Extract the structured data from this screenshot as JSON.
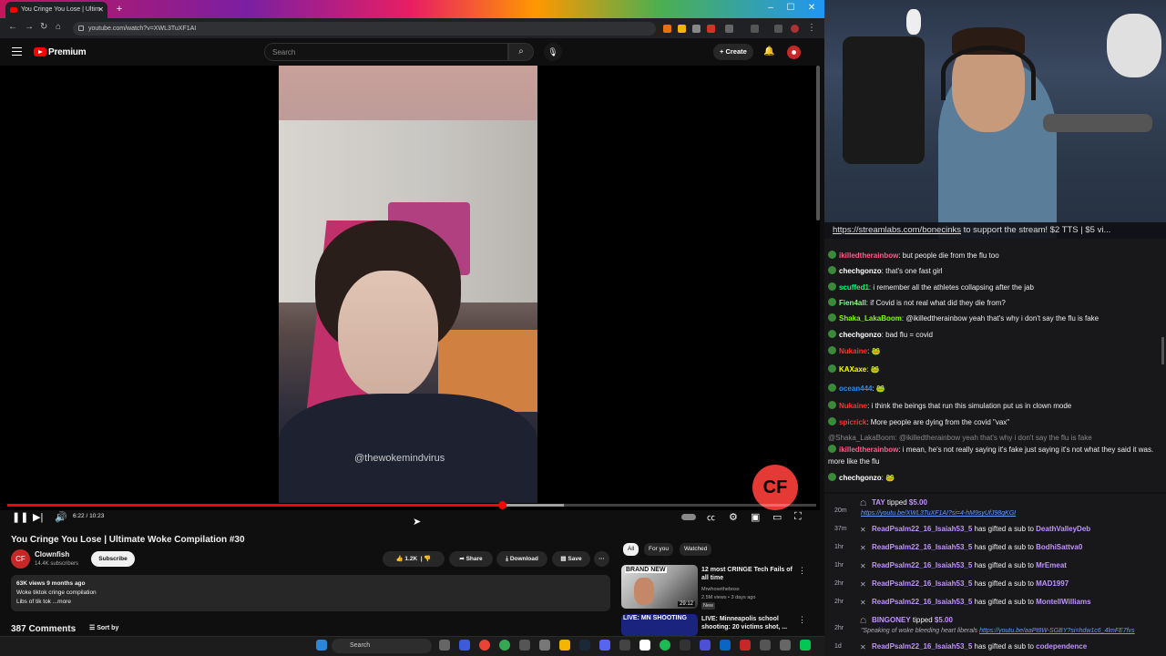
{
  "browser": {
    "tab_title": "You Cringe You Lose | Ultim",
    "tab_close": "✕",
    "new_tab": "+",
    "url": "youtube.com/watch?v=XWL3TuXF1AI",
    "win_minimize": "–",
    "win_maximize": "☐",
    "win_close": "✕"
  },
  "youtube": {
    "brand": "Premium",
    "search_placeholder": "Search",
    "create_label": "Create",
    "video": {
      "watermark": "@thewokemindvirus",
      "timecode": "6:22 / 10:23",
      "progress_fraction": 0.6116,
      "buffer_end_fraction": 0.688,
      "brand_logo_text": "CF"
    },
    "title": "You Cringe You Lose | Ultimate Woke Compilation #30",
    "channel": {
      "name": "Clownfish",
      "subscribers": "14.4K subscribers",
      "avatar_text": "CF"
    },
    "subscribe_label": "Subscribe",
    "actions": {
      "likes": "1.2K",
      "share": "Share",
      "download": "Download",
      "save": "Save",
      "more": "···"
    },
    "description": {
      "stats": "63K views  9 months ago",
      "line1": "Woke tiktok cringe compilation",
      "line2": "Libs of tik tok ...more"
    },
    "comments_count": "387 Comments",
    "sort_by": "Sort by",
    "chips": [
      "All",
      "For you",
      "Watched"
    ],
    "recommendations": [
      {
        "title": "12 most CRINGE Tech Fails of all time",
        "channel": "Mrwhosetheboss",
        "meta": "2.5M views • 3 days ago",
        "badge": "New",
        "duration": "29:12",
        "thumb_text": "BRAND NEW"
      },
      {
        "title": "LIVE: Minneapolis school shooting: 20 victims shot, ...",
        "thumb_text": "LIVE: MN SHOOTING"
      }
    ]
  },
  "stream": {
    "banner_link": "https://streamlabs.com/bonecinks",
    "banner_text": " to support the stream! $2 TTS | $5 vi..."
  },
  "chat": [
    {
      "user": "ikilledtherainbow",
      "color": "#ff5c8a",
      "text": "but people die from the flu too"
    },
    {
      "user": "chechgonzo",
      "color": "#ffffff",
      "text": "that's one fast girl"
    },
    {
      "user": "scuffed1",
      "color": "#00ff7f",
      "text": "i remember all the athletes collapsing after the jab"
    },
    {
      "user": "Fien4all",
      "color": "#7fff7f",
      "text": "if Covid is not real what did they die from?"
    },
    {
      "user": "Shaka_LakaBoom",
      "color": "#7fff00",
      "text": "@ikilledtherainbow yeah that's why i don't say the flu is fake"
    },
    {
      "user": "chechgonzo",
      "color": "#ffffff",
      "text": "bad flu = covid"
    },
    {
      "user": "Nukaine",
      "color": "#ff2f2f",
      "text": "🐸"
    },
    {
      "user": "KAXaxe",
      "color": "#ffff00",
      "text": "🐸"
    },
    {
      "user": "ocean444",
      "color": "#1e90ff",
      "text": "🐸"
    },
    {
      "user": "Nukaine",
      "color": "#ff2f2f",
      "text": "i think the beings that run this simulation put us in clown mode"
    },
    {
      "user": "spicrick",
      "color": "#ff2f2f",
      "text": "More people are dying from the covid \"vax\""
    },
    {
      "user": "",
      "color": "#888888",
      "text": "@Shaka_LakaBoom: @ikilledtherainbow yeah that's why i don't say the flu is fake"
    },
    {
      "user": "ikilledtherainbow",
      "color": "#ff5c8a",
      "text": "i mean, he's not really saying it's fake just saying it's not what they said it was. more like the flu"
    },
    {
      "user": "chechgonzo",
      "color": "#ffffff",
      "text": "🐸"
    }
  ],
  "events": [
    {
      "time": "20m",
      "type": "tip",
      "user": "TAY",
      "amount": "$5.00",
      "message": "https://youtu.be/XWL3TuXF1AI?si=4-hM9syUfJ98qKGI"
    },
    {
      "time": "37m",
      "type": "gift",
      "user": "ReadPsalm22_16_Isaiah53_5",
      "recipient": "DeathValleyDeb"
    },
    {
      "time": "1hr",
      "type": "gift",
      "user": "ReadPsalm22_16_Isaiah53_5",
      "recipient": "BodhiSattva0"
    },
    {
      "time": "1hr",
      "type": "gift",
      "user": "ReadPsalm22_16_Isaiah53_5",
      "recipient": "MrEmeat"
    },
    {
      "time": "2hr",
      "type": "gift",
      "user": "ReadPsalm22_16_Isaiah53_5",
      "recipient": "MAD1997"
    },
    {
      "time": "2hr",
      "type": "gift",
      "user": "ReadPsalm22_16_Isaiah53_5",
      "recipient": "MontellWilliams"
    },
    {
      "time": "2hr",
      "type": "tip",
      "user": "BINGONEY",
      "amount": "$5.00",
      "message": "\"Speaking of woke bleeding heart liberals ",
      "link": "https://youtu.be/aaPt8W-SGBY?si=hdw1c6_4lmFE7fvs"
    },
    {
      "time": "1d",
      "type": "gift",
      "user": "ReadPsalm22_16_Isaiah53_5",
      "recipient": "codependence"
    }
  ],
  "event_text": {
    "tipped": " tipped ",
    "gifted": " has gifted a sub to "
  },
  "taskbar": {
    "search_label": "Search"
  }
}
